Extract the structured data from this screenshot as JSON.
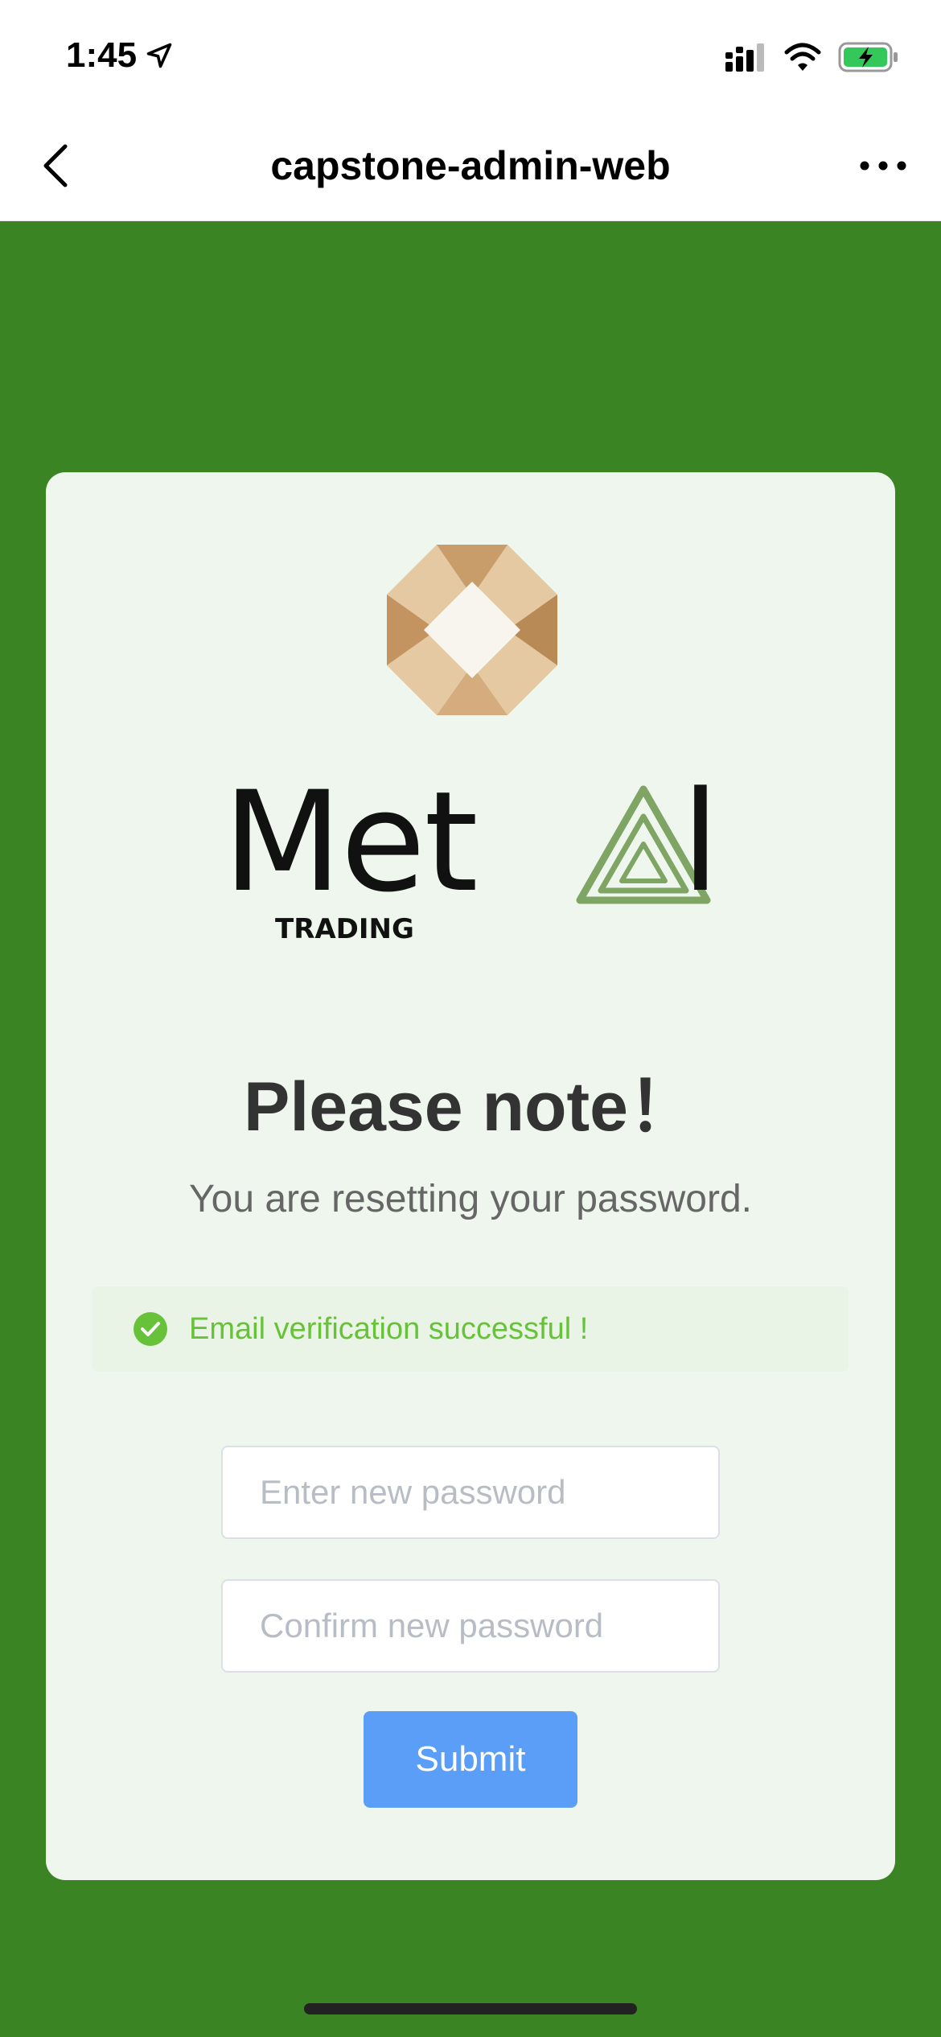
{
  "status_bar": {
    "time": "1:45"
  },
  "nav": {
    "title": "capstone-admin-web"
  },
  "brand": {
    "word": "Met",
    "word_end": "l",
    "sub": "TRADING"
  },
  "content": {
    "heading": "Please note！",
    "subtext": "You are resetting your password.",
    "alert": "Email verification successful !"
  },
  "form": {
    "new_password_placeholder": "Enter new password",
    "new_password_value": "",
    "confirm_password_placeholder": "Confirm new password",
    "confirm_password_value": "",
    "submit_label": "Submit"
  },
  "colors": {
    "background": "#3a8424",
    "card": "#eef6ee",
    "success": "#67c23a",
    "primary_button": "#5b9ef7"
  }
}
